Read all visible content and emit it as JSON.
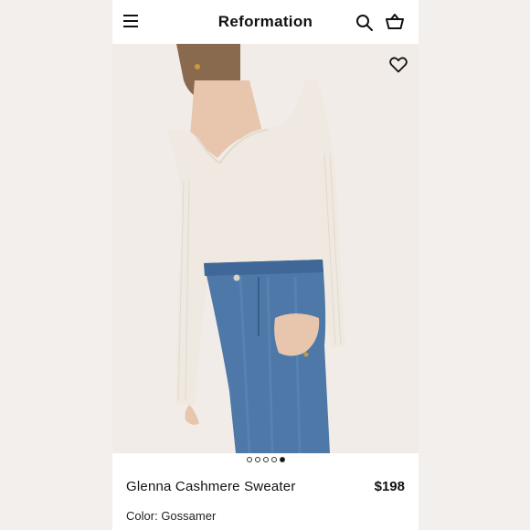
{
  "header": {
    "brand": "Reformation",
    "menu_icon": "hamburger-menu-icon",
    "search_icon": "search-icon",
    "cart_icon": "shopping-basket-icon"
  },
  "hero": {
    "favorite_icon": "heart-outline-icon",
    "carousel": {
      "total": 5,
      "active_index": 5
    }
  },
  "product": {
    "name": "Glenna Cashmere Sweater",
    "price": "$198",
    "color_label": "Color:",
    "color_value": "Gossamer"
  },
  "colors": {
    "background": "#ffffff",
    "outer_background": "#f3efec",
    "text": "#111111",
    "sweater": "#efe9e1",
    "denim": "#4d78a8"
  }
}
